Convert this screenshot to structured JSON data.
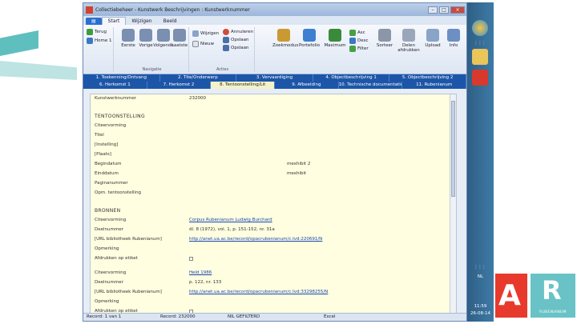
{
  "window": {
    "title": "Collectiebeheer - Kunstwerk Beschrijvingen : Kunstwerknummer",
    "tabs": [
      "Start",
      "Wijzigen",
      "Beeld"
    ]
  },
  "ribbon": {
    "left_items": [
      "Terug",
      "Home 1"
    ],
    "nav_buttons": [
      "Eerste",
      "Vorige",
      "Volgende",
      "Laatste"
    ],
    "nav_group": "Navigatie",
    "action_items": [
      "Wijzigen",
      "Nieuw",
      "Annuleren",
      "Opslaan",
      "Opslaan"
    ],
    "action_group": "Acties",
    "other_buttons": [
      "Zoekmodus",
      "Portefolio",
      "Maximum",
      "Sorteer",
      "Delen afdrukken",
      "Upload",
      "Info"
    ],
    "sort_items": [
      "Asc",
      "Desc",
      "Filter"
    ]
  },
  "record_tabs_row1": [
    "1. Toekenning/Ontvang",
    "2. Tite/Onderwerp",
    "3. Vervaardiging",
    "4. Objectbeschrijving 1",
    "5. Objectbeschrijving 2"
  ],
  "record_tabs_row2": [
    "6. Herkomst 1",
    "7. Herkomst 2",
    "8. Tentoonstelling/Lit",
    "9. Afbeelding",
    "10. Technische documentatie",
    "11. Rubenianum"
  ],
  "record": {
    "kunstwerk_label": "Kunstwerknummer",
    "kunstwerk_value": "232000",
    "section_tentoonstelling": "TENTOONSTELLING",
    "tentoon_fields": [
      {
        "label": "Citeervorming",
        "value": "",
        "extra": ""
      },
      {
        "label": "Titel",
        "value": "",
        "extra": ""
      },
      {
        "label": "[Instelling]",
        "value": "",
        "extra": ""
      },
      {
        "label": "[Plaats]",
        "value": "",
        "extra": ""
      },
      {
        "label": "Begindatum",
        "value": "",
        "extra": "mexhibit 2"
      },
      {
        "label": "Einddatum",
        "value": "",
        "extra": "mexhibit"
      },
      {
        "label": "Paginanummer",
        "value": "",
        "extra": ""
      },
      {
        "label": "Opm. tentoonstelling",
        "value": "",
        "extra": ""
      }
    ],
    "section_bronnen": "BRONNEN",
    "bron1": [
      {
        "label": "Citeervorming",
        "value": "Corpus Rubenianum Ludwig Burchard",
        "link": true
      },
      {
        "label": "Deelnummer",
        "value": "dl. 8 (1972), vol. 1, p. 151-152, nr. 31a",
        "link": false
      },
      {
        "label": "[URL bibliotheek Rubenianum]",
        "value": "http://anet.ua.ac.be/record/opacrubenianum/c:lvd:220691/N",
        "link": true
      },
      {
        "label": "Opmerking",
        "value": "",
        "link": false
      },
      {
        "label": "Afdrukken op etiket",
        "value": "",
        "link": false,
        "checkbox": true
      }
    ],
    "bron2": [
      {
        "label": "Citeervorming",
        "value": "Held 1986",
        "link": true
      },
      {
        "label": "Deelnummer",
        "value": "p. 122, nr. 133",
        "link": false
      },
      {
        "label": "[URL bibliotheek Rubenianum]",
        "value": "http://anet.ua.ac.be/record/opacrubenianum/c:lvd:33298255/N",
        "link": true
      },
      {
        "label": "Opmerking",
        "value": "",
        "link": false
      },
      {
        "label": "Afdrukken op etiket",
        "value": "",
        "link": false,
        "checkbox": true
      }
    ]
  },
  "status": {
    "record_text": "Record: 232000",
    "left_text": "Record: 1 van 1",
    "filter_text": "NIL GEFILTERD",
    "right_text": "Excel"
  },
  "taskbar": {
    "lang": "NL",
    "time": "11:59",
    "date": "26-08-14"
  },
  "logos": {
    "left_glyph": "A",
    "right_glyph": "R",
    "right_text": "RUBENIANUM"
  }
}
